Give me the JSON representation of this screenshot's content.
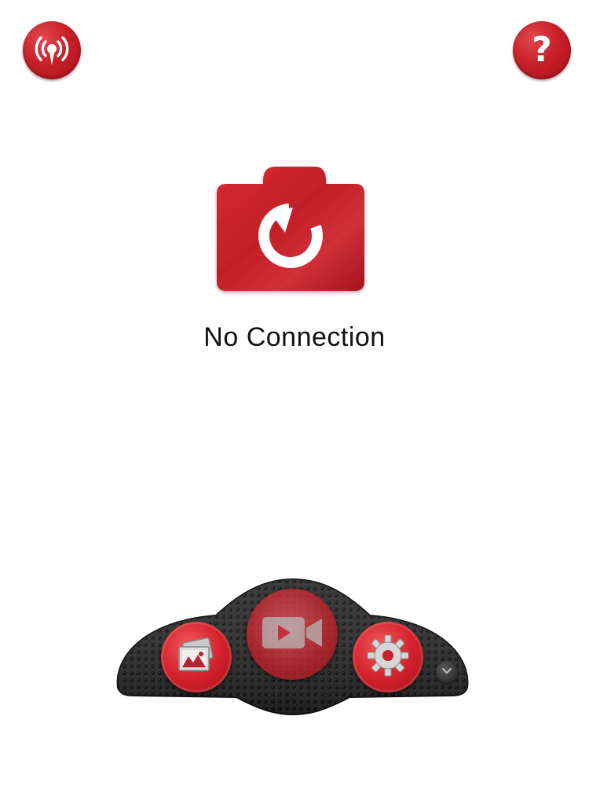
{
  "status": {
    "message": "No Connection"
  },
  "top_bar": {
    "left_button_icon": "broadcast-icon",
    "right_button_icon": "help-icon",
    "right_button_glyph": "?"
  },
  "center": {
    "icon": "camera-refresh-icon"
  },
  "dock": {
    "buttons": [
      {
        "icon": "gallery-icon"
      },
      {
        "icon": "video-camera-icon"
      },
      {
        "icon": "settings-gear-icon"
      },
      {
        "icon": "chevron-down-icon"
      }
    ]
  },
  "colors": {
    "accent": "#c8202a",
    "accent_light": "#e04a4f",
    "dock_bg": "#1e1e1e",
    "text": "#111111",
    "background": "#ffffff"
  }
}
